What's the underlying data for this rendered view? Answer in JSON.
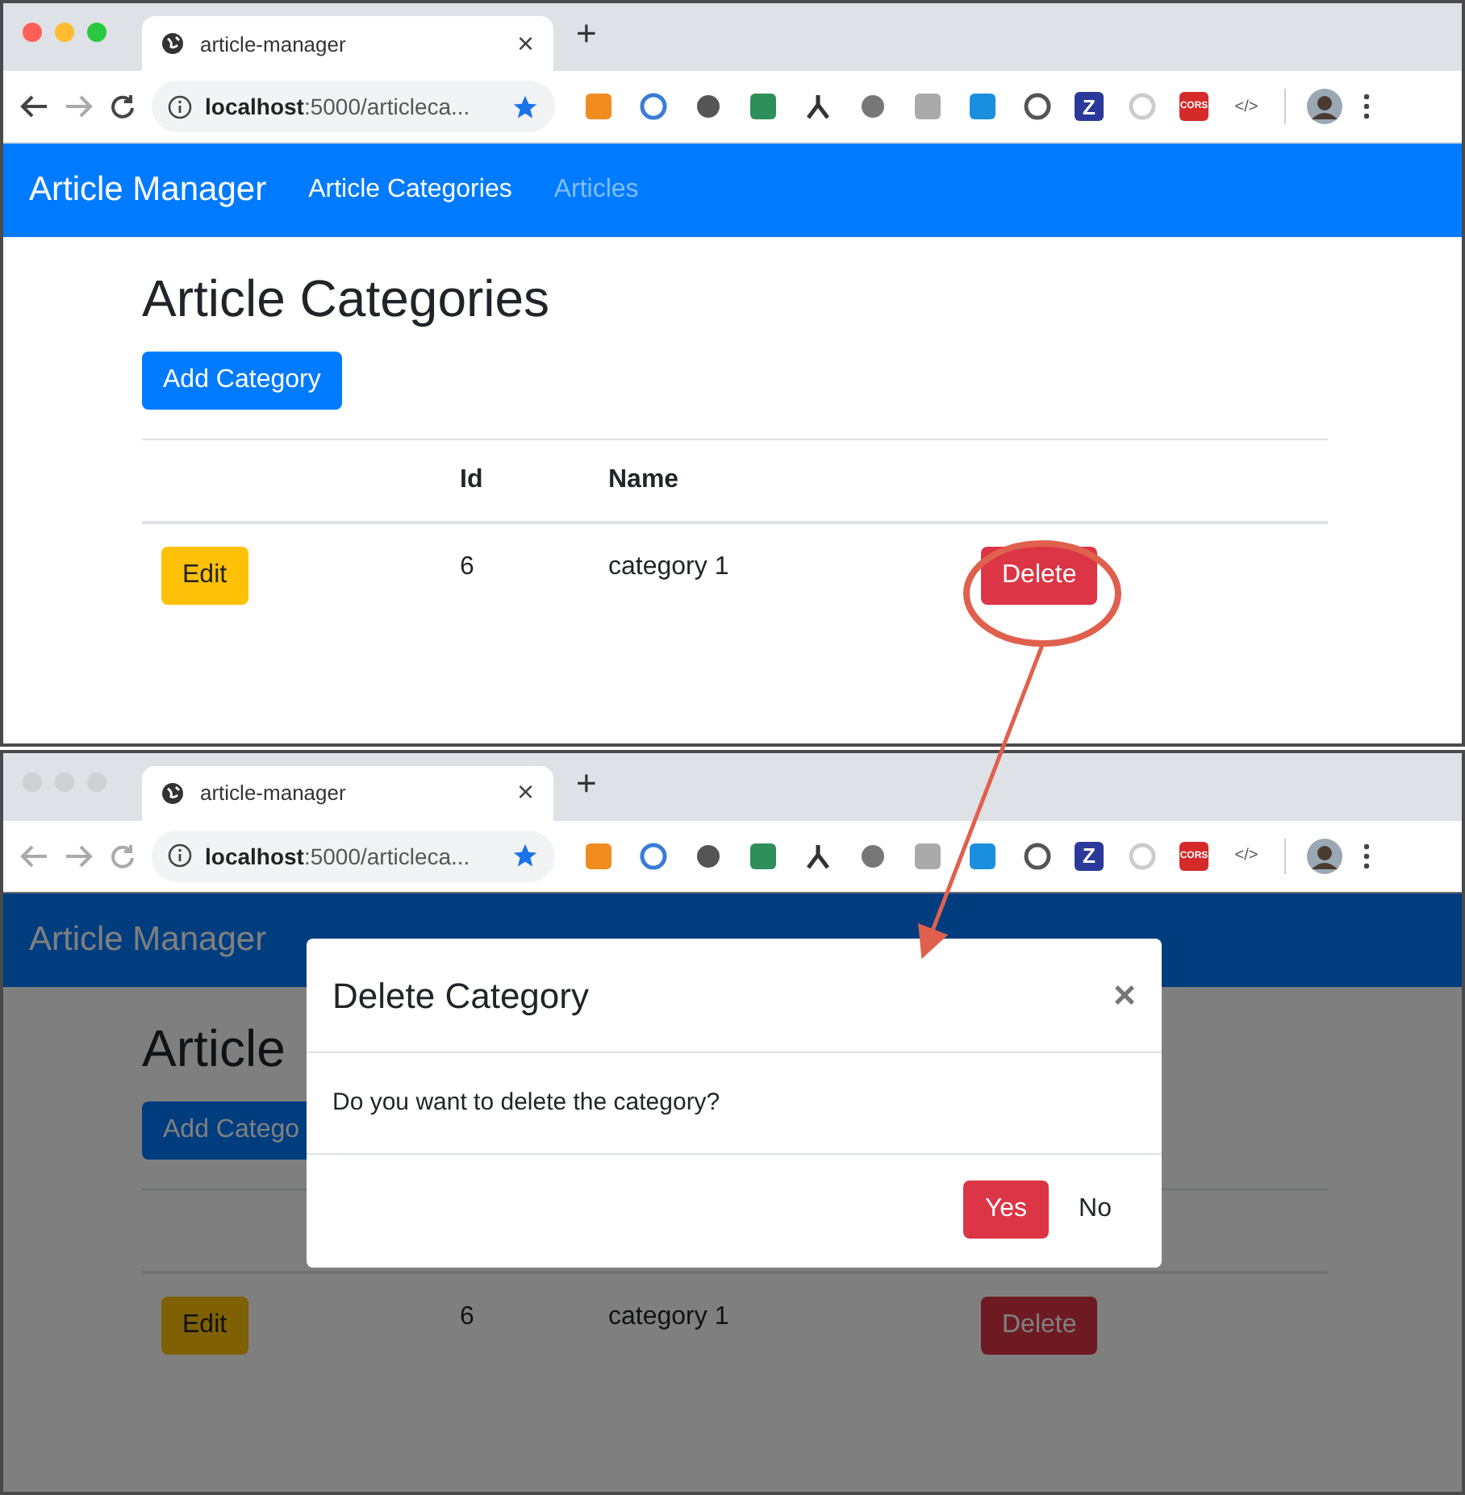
{
  "windows": [
    {
      "active": true,
      "tab": {
        "title": "article-manager",
        "close": "×"
      },
      "new_tab": "+",
      "url": "**localhost**:5000/articleca...",
      "extensions": [
        {
          "kind": "square",
          "color": "#f08c20"
        },
        {
          "kind": "ring",
          "color": "#3a7bd5"
        },
        {
          "kind": "circle",
          "color": "#555555"
        },
        {
          "kind": "square",
          "color": "#2f8f5a"
        },
        {
          "kind": "fork",
          "color": "#333333"
        },
        {
          "kind": "circle",
          "color": "#777777"
        },
        {
          "kind": "square",
          "color": "#aaaaaa"
        },
        {
          "kind": "square",
          "color": "#1a8fe0"
        },
        {
          "kind": "ring",
          "color": "#555555"
        },
        {
          "kind": "text",
          "label": "Z",
          "color": "#2b3a9a"
        },
        {
          "kind": "ring",
          "color": "#cccccc"
        },
        {
          "kind": "text",
          "label": "CORS",
          "color": "#d42a2a"
        },
        {
          "kind": "code",
          "label": "</>",
          "color": "#555555"
        }
      ],
      "brand": "Article Manager",
      "nav": [
        {
          "label": "Article Categories",
          "selected": true
        },
        {
          "label": "Articles",
          "selected": false
        }
      ],
      "page": {
        "heading": "Article Categories",
        "add_button": "Add Category",
        "columns": [
          "Id",
          "Name"
        ],
        "rows": [
          {
            "edit": "Edit",
            "id": "6",
            "name": "category 1",
            "delete": "Delete"
          }
        ]
      }
    },
    {
      "active": false,
      "tab": {
        "title": "article-manager",
        "close": "×"
      },
      "new_tab": "+",
      "url": "**localhost**:5000/articleca...",
      "extensions": [
        {
          "kind": "square",
          "color": "#f08c20"
        },
        {
          "kind": "ring",
          "color": "#3a7bd5"
        },
        {
          "kind": "circle",
          "color": "#555555"
        },
        {
          "kind": "square",
          "color": "#2f8f5a"
        },
        {
          "kind": "fork",
          "color": "#333333"
        },
        {
          "kind": "circle",
          "color": "#777777"
        },
        {
          "kind": "square",
          "color": "#aaaaaa"
        },
        {
          "kind": "square",
          "color": "#1a8fe0"
        },
        {
          "kind": "ring",
          "color": "#555555"
        },
        {
          "kind": "text",
          "label": "Z",
          "color": "#2b3a9a"
        },
        {
          "kind": "ring",
          "color": "#cccccc"
        },
        {
          "kind": "text",
          "label": "CORS",
          "color": "#d42a2a"
        },
        {
          "kind": "code",
          "label": "</>",
          "color": "#555555"
        }
      ],
      "brand": "Article Manager",
      "page": {
        "heading": "Article",
        "add_button": "Add Catego",
        "rows": [
          {
            "edit": "Edit",
            "id": "6",
            "name": "category 1",
            "delete": "Delete"
          }
        ]
      },
      "modal": {
        "title": "Delete Category",
        "close": "×",
        "message": "Do you want to delete the category?",
        "buttons": [
          {
            "label": "Yes",
            "kind": "danger"
          },
          {
            "label": "No",
            "kind": "plain"
          }
        ]
      }
    }
  ]
}
